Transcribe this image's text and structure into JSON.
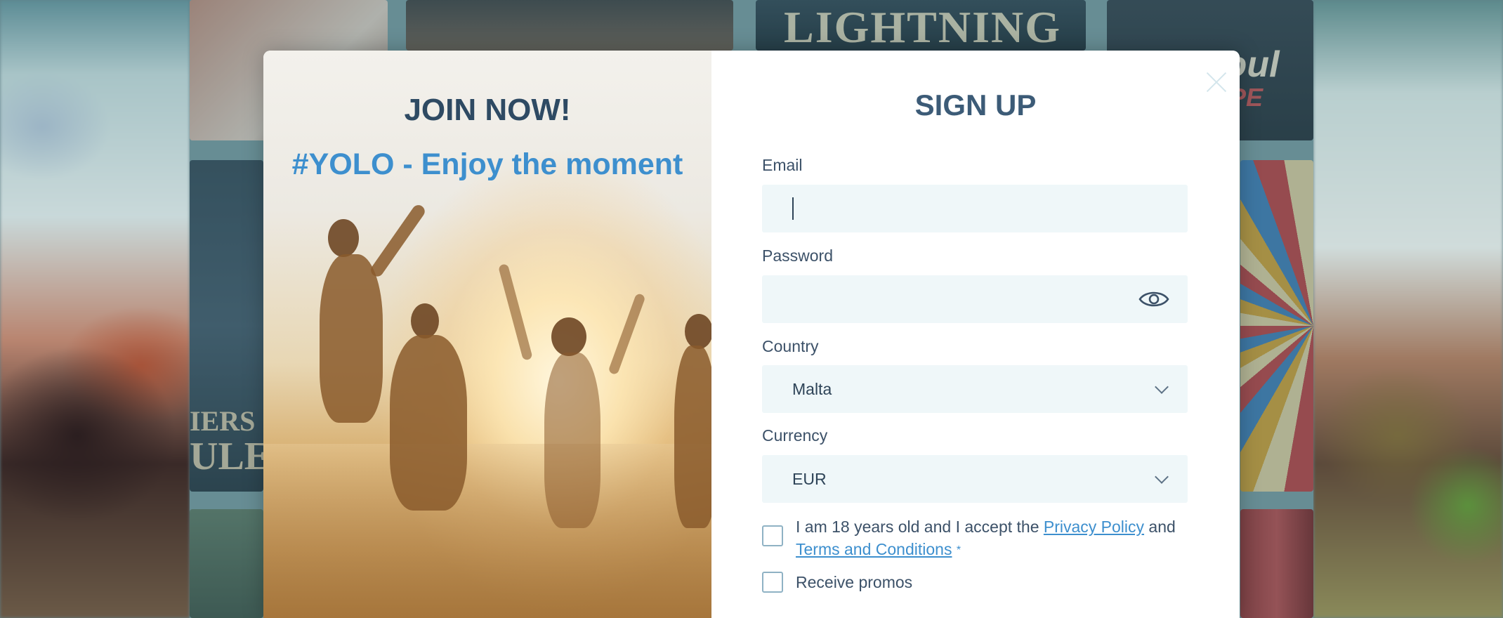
{
  "colors": {
    "title_dark": "#2e4a63",
    "accent_blue": "#3d8fce",
    "field_bg": "#eff7f9",
    "label": "#3c5168"
  },
  "background": {
    "tile_texts": [
      "LIGHTNING",
      "Roul",
      "SPE",
      "IERS",
      "ULE"
    ]
  },
  "promo": {
    "title": "JOIN NOW!",
    "subtitle": "#YOLO - Enjoy the moment"
  },
  "signup": {
    "title": "SIGN UP",
    "close_icon": "close-icon",
    "email": {
      "label": "Email",
      "value": "",
      "placeholder": ""
    },
    "password": {
      "label": "Password",
      "value": "",
      "toggle_icon": "eye-icon"
    },
    "country": {
      "label": "Country",
      "selected": "Malta",
      "icon": "chevron-down-icon"
    },
    "currency": {
      "label": "Currency",
      "selected": "EUR",
      "icon": "chevron-down-icon"
    },
    "terms": {
      "text_before": "I am 18 years old and I accept the ",
      "privacy_link": "Privacy Policy",
      "text_and": " and",
      "terms_link": "Terms and Conditions",
      "required_mark": "*",
      "checked": false
    },
    "promos": {
      "label": "Receive promos",
      "checked": false
    }
  }
}
